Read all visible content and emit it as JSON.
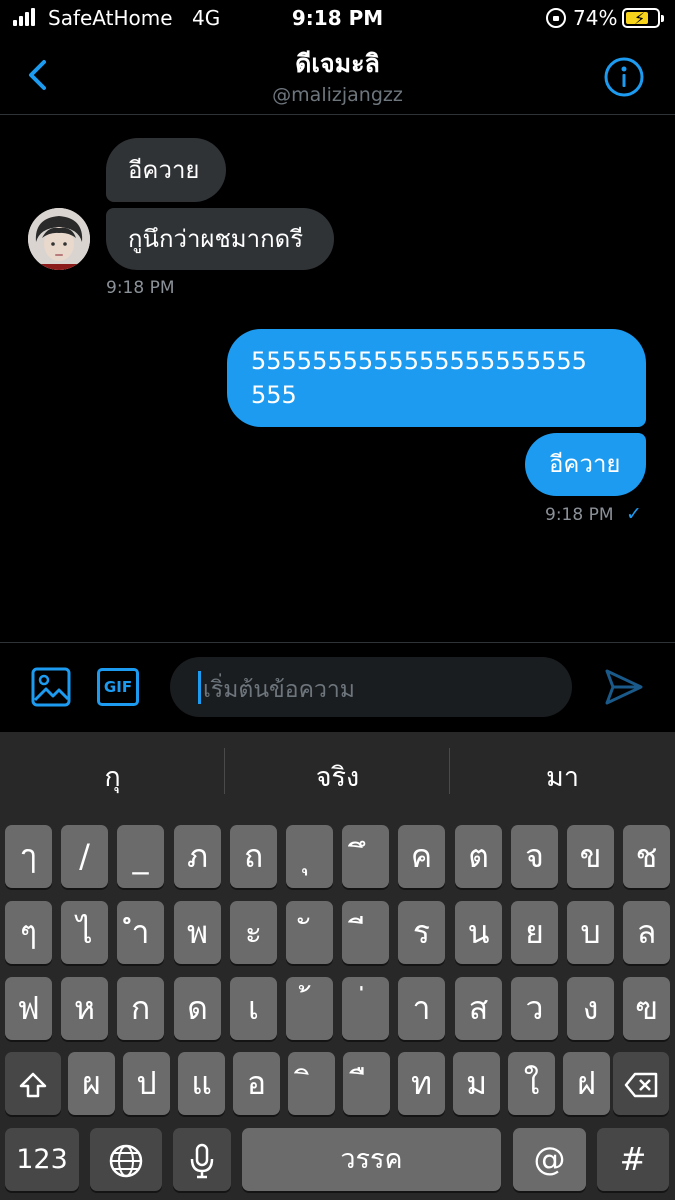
{
  "status_bar": {
    "carrier": "SafeAtHome",
    "network": "4G",
    "time": "9:18 PM",
    "battery": "74%",
    "battery_level": 0.74
  },
  "header": {
    "title": "ดีเจมะลิ",
    "handle": "@malizjangzz"
  },
  "messages": {
    "incoming": [
      {
        "text": "อีควาย"
      },
      {
        "text": "กูนึกว่าผชมากดรี"
      }
    ],
    "incoming_time": "9:18 PM",
    "outgoing": [
      {
        "line1": "5555555555555555555555",
        "line2": "555"
      },
      {
        "text": "อีควาย"
      }
    ],
    "outgoing_time": "9:18 PM",
    "read_mark": "✓"
  },
  "composer": {
    "gif_label": "GIF",
    "placeholder": "เริ่มต้นข้อความ"
  },
  "keyboard": {
    "suggestions": [
      "กุ",
      "จริง",
      "มา"
    ],
    "row1": [
      "ๅ",
      "/",
      "_",
      "ภ",
      "ถ",
      "ุ",
      "ึ",
      "ค",
      "ต",
      "จ",
      "ข",
      "ช"
    ],
    "row2": [
      "ๆ",
      "ไ",
      "ำ",
      "พ",
      "ะ",
      "ั",
      "ี",
      "ร",
      "น",
      "ย",
      "บ",
      "ล"
    ],
    "row3": [
      "ฟ",
      "ห",
      "ก",
      "ด",
      "เ",
      "้",
      "่",
      "า",
      "ส",
      "ว",
      "ง",
      "ฃ"
    ],
    "row4": [
      "ผ",
      "ป",
      "แ",
      "อ",
      "ิ",
      "ื",
      "ท",
      "ม",
      "ใ",
      "ฝ"
    ],
    "numbers_label": "123",
    "space_label": "วรรค",
    "at_label": "@",
    "hash_label": "#"
  },
  "colors": {
    "accent": "#1d9bf0",
    "incoming_bubble": "#2f3336",
    "keyboard_bg": "#282828",
    "key": "#6b6b6b"
  },
  "icons": [
    "back-chevron-icon",
    "info-icon",
    "image-icon",
    "gif-icon",
    "send-icon",
    "shift-icon",
    "backspace-icon",
    "globe-icon",
    "microphone-icon"
  ]
}
